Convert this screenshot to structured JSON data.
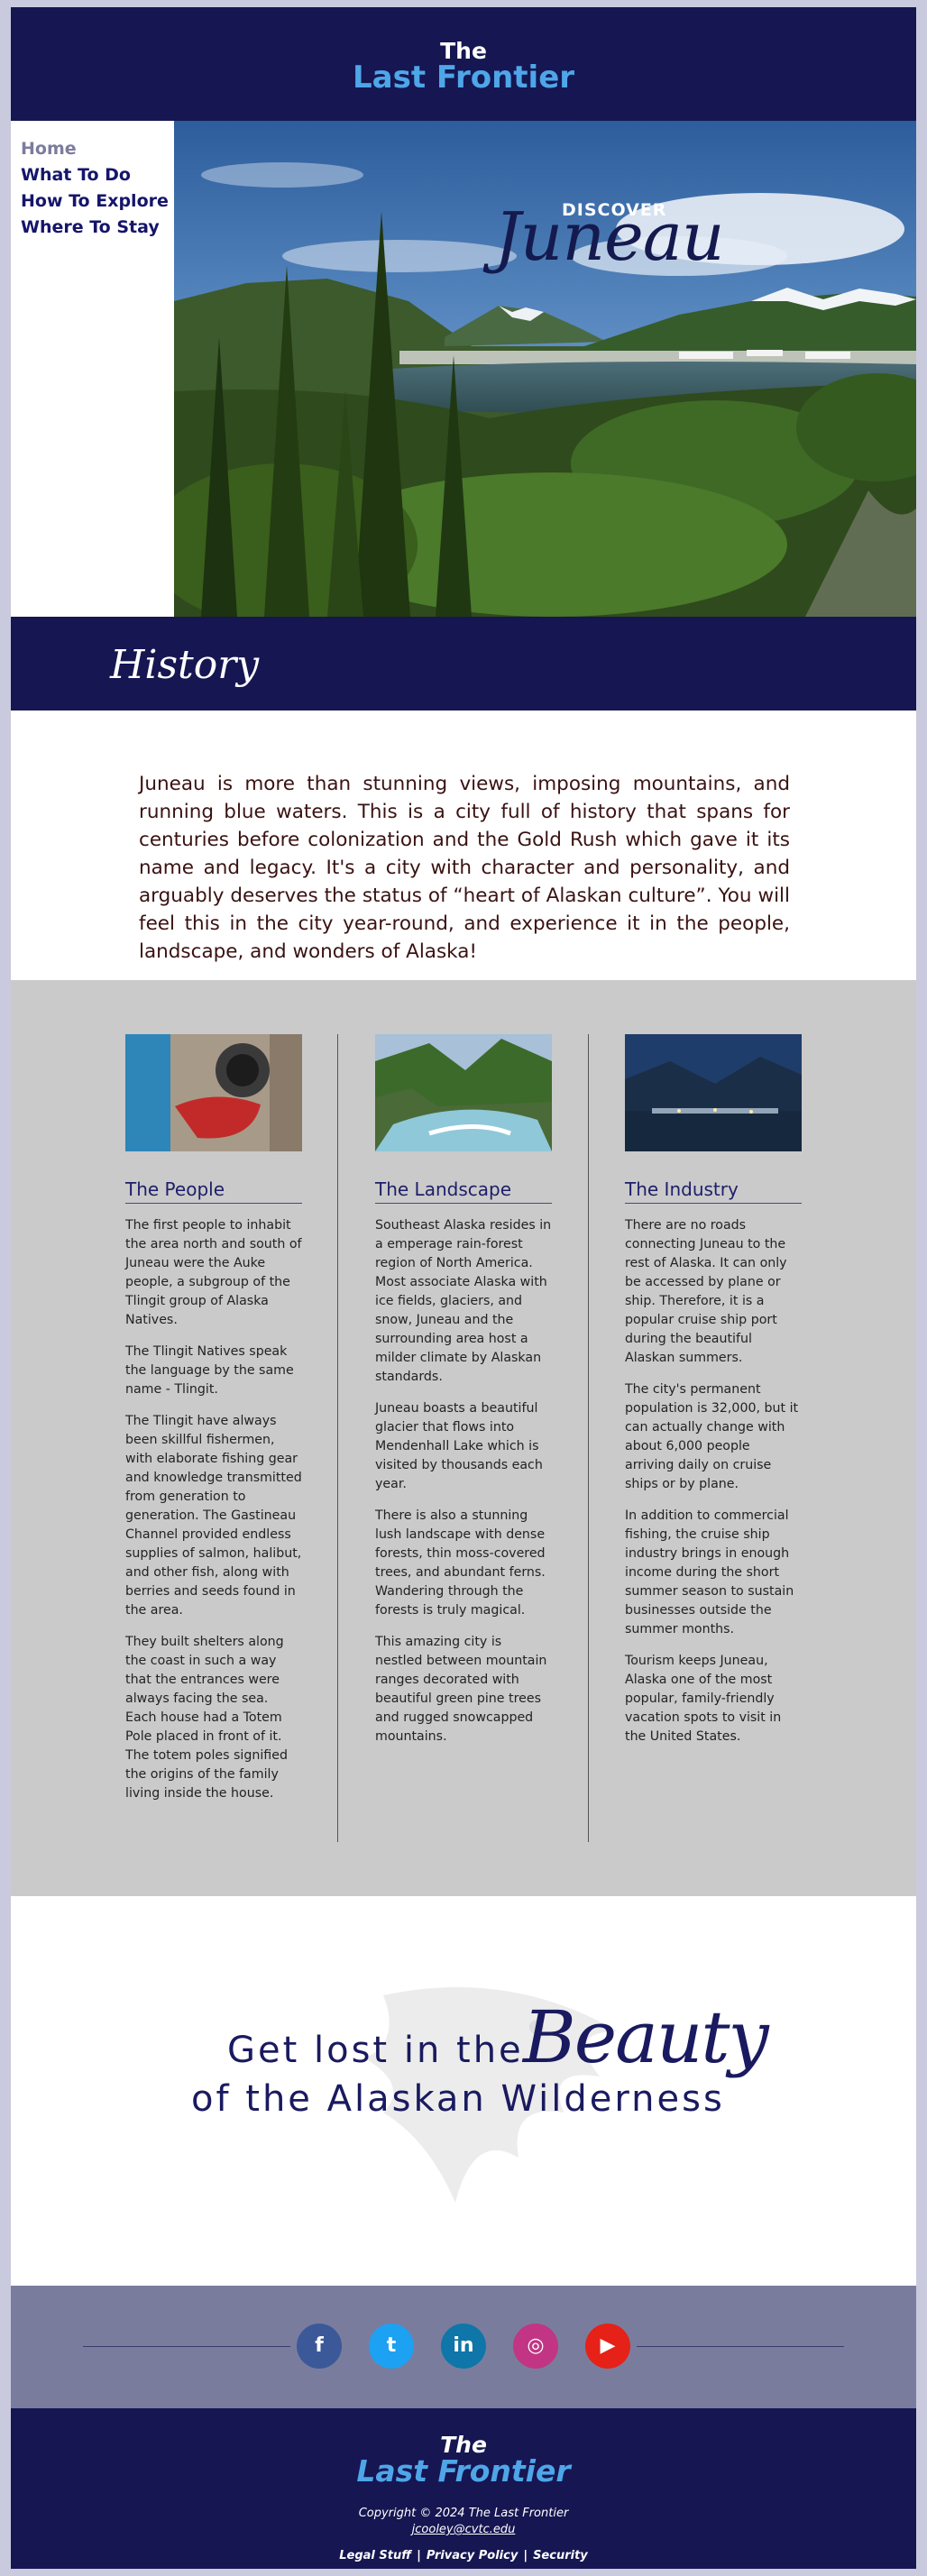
{
  "header": {
    "the": "The",
    "name": "Last Frontier"
  },
  "nav": [
    {
      "label": "Home"
    },
    {
      "label": "What To Do"
    },
    {
      "label": "How To Explore"
    },
    {
      "label": "Where To Stay"
    }
  ],
  "hero": {
    "discover": "DISCOVER",
    "city": "Juneau"
  },
  "history": {
    "heading": "History",
    "text": "Juneau is more than stunning views, imposing mountains, and running blue waters. This is a city full of history that spans for centuries before colonization and the Gold Rush which gave it its name and legacy. It's a city with character and personality, and arguably deserves the status of “heart of Alaskan culture”. You will feel this in the city year-round, and experience it in the people, landscape, and wonders of Alaska!"
  },
  "columns": [
    {
      "title": "The People",
      "paragraphs": [
        "The first people to inhabit the area north and south of Juneau were the Auke people, a subgroup of the Tlingit group of Alaska Natives.",
        "The Tlingit Natives speak the language by the same name - Tlingit.",
        "The Tlingit have always been skillful fishermen, with elaborate fishing gear and knowledge transmitted from generation to generation. The Gastineau Channel provided endless supplies of salmon, halibut, and other fish, along with berries and seeds found in the area.",
        "They built shelters along the coast in such a way that the entrances were always facing the sea. Each house had a Totem Pole placed in front of it. The totem poles signified the origins of the family living inside the house."
      ]
    },
    {
      "title": "The Landscape",
      "paragraphs": [
        "Southeast Alaska resides in a emperage rain-forest region of North America. Most associate Alaska with ice fields, glaciers, and snow, Juneau and the surrounding area host a milder climate by Alaskan standards.",
        "Juneau boasts a beautiful glacier that flows into Mendenhall Lake which is visited by thousands each year.",
        "There is also a stunning lush landscape with dense forests, thin moss-covered trees, and abundant ferns. Wandering through the forests is truly magical.",
        "This amazing city is nestled between mountain ranges decorated with beautiful green pine trees and rugged snowcapped mountains."
      ]
    },
    {
      "title": "The Industry",
      "paragraphs": [
        "There are no roads connecting Juneau to the rest of Alaska. It can only be accessed by plane or ship. Therefore, it is a popular cruise ship port during the beautiful Alaskan summers.",
        "The city's permanent population is 32,000, but it can actually change with about 6,000 people arriving daily on cruise ships or by plane.",
        "In addition to commercial fishing, the cruise ship industry brings in enough income during the short summer season to sustain businesses outside the summer months.",
        "Tourism keeps Juneau, Alaska one of the most popular, family-friendly vacation spots to visit in the United States."
      ]
    }
  ],
  "beauty": {
    "line1": "Get lost in the",
    "word": "Beauty",
    "line2": "of the Alaskan Wilderness"
  },
  "social": [
    {
      "name": "facebook-icon",
      "glyph": "f",
      "color": "#3b5998"
    },
    {
      "name": "twitter-icon",
      "glyph": "t",
      "color": "#1da1f2"
    },
    {
      "name": "linkedin-icon",
      "glyph": "in",
      "color": "#0e76a8"
    },
    {
      "name": "instagram-icon",
      "glyph": "◎",
      "color": "#c13584"
    },
    {
      "name": "youtube-icon",
      "glyph": "▶",
      "color": "#e62117"
    }
  ],
  "footer": {
    "the": "The",
    "name": "Last Frontier",
    "copyright": "Copyright © 2024 The Last Frontier",
    "email": "jcooley@cvtc.edu",
    "links": [
      "Legal Stuff",
      "Privacy Policy",
      "Security"
    ]
  },
  "colors": {
    "navy": "#161652",
    "accent": "#4ea6e8",
    "gray": "#cacaca",
    "socialBar": "#7a7c9e"
  }
}
